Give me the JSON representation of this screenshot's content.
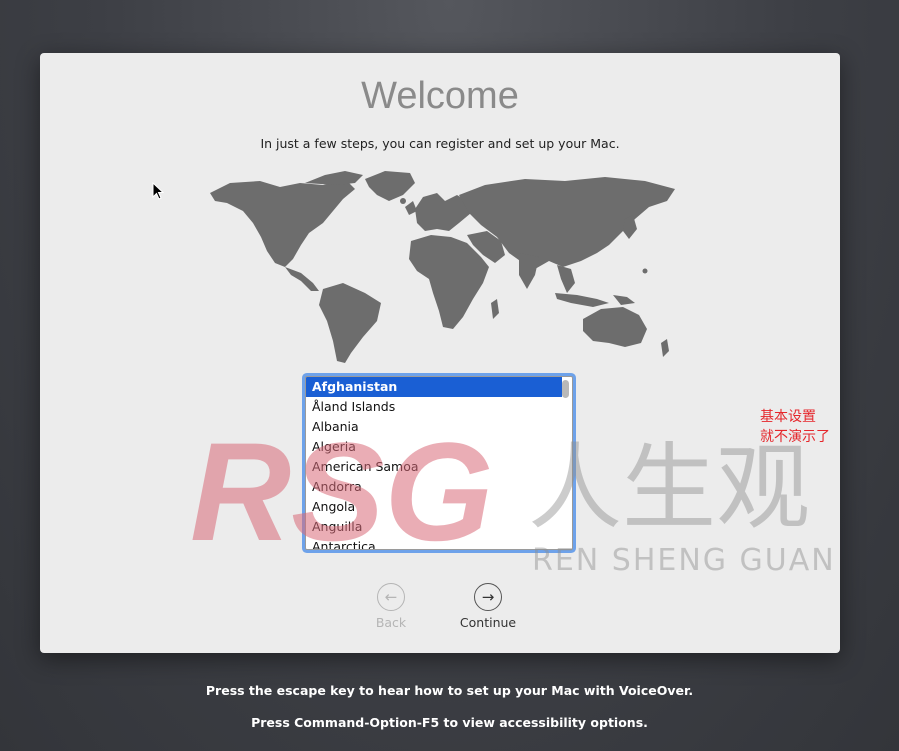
{
  "window": {
    "title": "Welcome",
    "subtitle": "In just a few steps, you can register and set up your Mac."
  },
  "map": {
    "icon": "world-map-icon",
    "color": "#6d6d6d"
  },
  "country_list": {
    "selected": "Afghanistan",
    "items": [
      "Afghanistan",
      "Åland Islands",
      "Albania",
      "Algeria",
      "American Samoa",
      "Andorra",
      "Angola",
      "Anguilla",
      "Antarctica"
    ],
    "accent": "#1a5fd4"
  },
  "navigation": {
    "back_label": "Back",
    "back_enabled": false,
    "continue_label": "Continue"
  },
  "annotation": {
    "line1": "基本设置",
    "line2": "就不演示了",
    "color": "#e5262b"
  },
  "watermark": {
    "logo": "RSG",
    "chinese": "人生观",
    "pinyin": "REN SHENG GUAN"
  },
  "footer": {
    "voiceover_hint": "Press the escape key to hear how to set up your Mac with VoiceOver.",
    "accessibility_hint": "Press Command-Option-F5 to view accessibility options."
  }
}
